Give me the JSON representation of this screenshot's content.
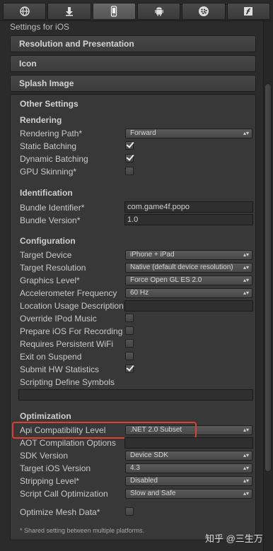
{
  "tabs": [
    {
      "icon": "globe-icon",
      "active": false
    },
    {
      "icon": "download-icon",
      "active": false
    },
    {
      "icon": "iphone-icon",
      "active": true
    },
    {
      "icon": "android-icon",
      "active": false
    },
    {
      "icon": "blackberry-icon",
      "active": false
    },
    {
      "icon": "flash-icon",
      "active": false
    }
  ],
  "title": "Settings for iOS",
  "sections": {
    "resolution": "Resolution and Presentation",
    "icon": "Icon",
    "splash": "Splash Image",
    "other": "Other Settings"
  },
  "rendering": {
    "heading": "Rendering",
    "rendering_path_label": "Rendering Path*",
    "rendering_path_value": "Forward",
    "static_batching_label": "Static Batching",
    "static_batching_checked": true,
    "dynamic_batching_label": "Dynamic Batching",
    "dynamic_batching_checked": true,
    "gpu_skinning_label": "GPU Skinning*",
    "gpu_skinning_checked": false
  },
  "identification": {
    "heading": "Identification",
    "bundle_id_label": "Bundle Identifier*",
    "bundle_id_value": "com.game4f.popo",
    "bundle_version_label": "Bundle Version*",
    "bundle_version_value": "1.0"
  },
  "configuration": {
    "heading": "Configuration",
    "target_device_label": "Target Device",
    "target_device_value": "iPhone + iPad",
    "target_resolution_label": "Target Resolution",
    "target_resolution_value": "Native (default device resolution)",
    "graphics_level_label": "Graphics Level*",
    "graphics_level_value": "Force Open GL ES 2.0",
    "accelerometer_label": "Accelerometer Frequency",
    "accelerometer_value": "60 Hz",
    "location_usage_label": "Location Usage Description",
    "location_usage_value": "",
    "override_ipod_label": "Override IPod Music",
    "prepare_ios_label": "Prepare iOS For Recording",
    "requires_wifi_label": "Requires Persistent WiFi",
    "exit_suspend_label": "Exit on Suspend",
    "submit_hw_label": "Submit HW Statistics",
    "submit_hw_checked": true,
    "scripting_define_label": "Scripting Define Symbols",
    "scripting_define_value": ""
  },
  "optimization": {
    "heading": "Optimization",
    "api_compat_label": "Api Compatibility Level",
    "api_compat_value": ".NET 2.0 Subset",
    "aot_label": "AOT Compilation Options",
    "aot_value": "",
    "sdk_version_label": "SDK Version",
    "sdk_version_value": "Device SDK",
    "target_ios_label": "Target iOS Version",
    "target_ios_value": "4.3",
    "stripping_label": "Stripping Level*",
    "stripping_value": "Disabled",
    "script_call_label": "Script Call Optimization",
    "script_call_value": "Slow and Safe",
    "optimize_mesh_label": "Optimize Mesh Data*",
    "optimize_mesh_checked": false
  },
  "footnote": "* Shared setting between multiple platforms.",
  "watermark": "知乎 @三生万",
  "colors": {
    "highlight": "#e0402e",
    "panel": "#383838",
    "background": "#2b2b2b"
  }
}
